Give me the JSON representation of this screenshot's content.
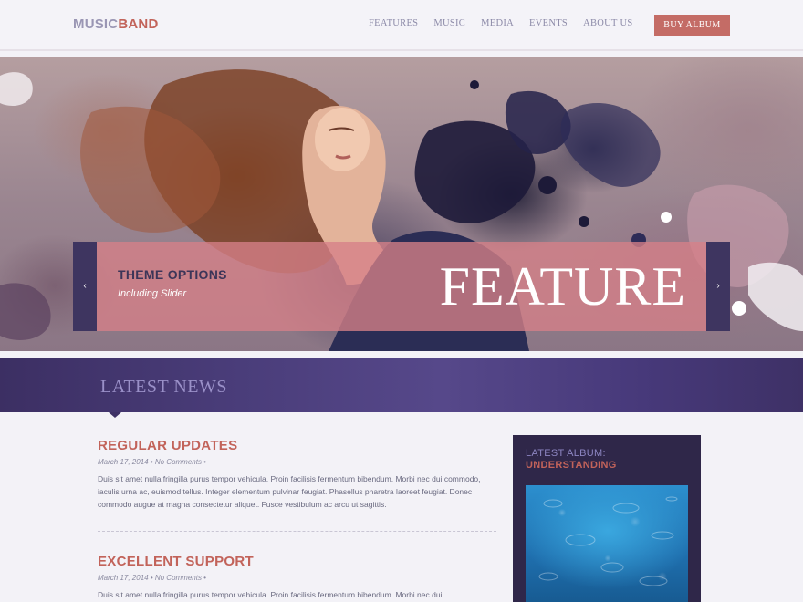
{
  "header": {
    "logo_part1": "MUSIC",
    "logo_part2": "BAND",
    "nav": [
      "FEATURES",
      "MUSIC",
      "MEDIA",
      "EVENTS",
      "ABOUT US"
    ],
    "buy_button": "BUY ALBUM"
  },
  "slider": {
    "title": "THEME OPTIONS",
    "subtitle": "Including Slider",
    "big_text": "FEATURE",
    "prev_icon": "‹",
    "next_icon": "›"
  },
  "news": {
    "heading": "LATEST NEWS",
    "posts": [
      {
        "title": "REGULAR UPDATES",
        "meta": "March 17, 2014 • No Comments •",
        "body": "Duis sit amet nulla fringilla purus tempor vehicula. Proin facilisis fermentum bibendum. Morbi nec dui commodo, iaculis urna ac, euismod tellus. Integer elementum pulvinar feugiat. Phasellus pharetra laoreet feugiat. Donec commodo augue at magna consectetur aliquet. Fusce vestibulum ac arcu ut sagittis."
      },
      {
        "title": "EXCELLENT SUPPORT",
        "meta": "March 17, 2014 • No Comments •",
        "body": "Duis sit amet nulla fringilla purus tempor vehicula. Proin facilisis fermentum bibendum. Morbi nec dui"
      }
    ]
  },
  "sidebar": {
    "album_label": "LATEST ALBUM:",
    "album_name": "UNDERSTANDING"
  },
  "colors": {
    "accent": "#c2635a",
    "band": "#4a3d7a",
    "sidebar_bg": "#2f2749"
  }
}
